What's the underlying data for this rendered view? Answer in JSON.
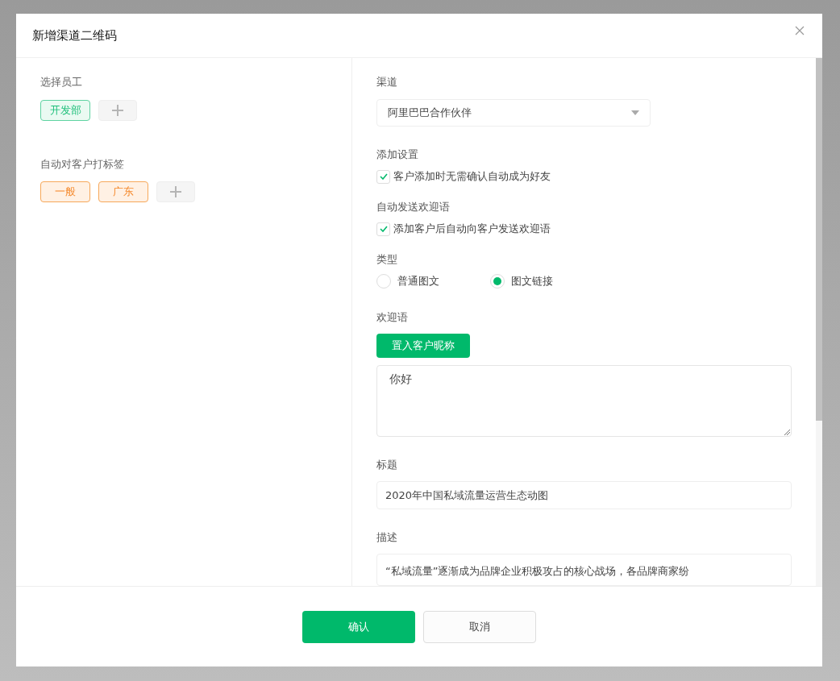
{
  "dialog": {
    "title": "新增渠道二维码"
  },
  "employees": {
    "label": "选择员工",
    "tags": [
      {
        "label": "开发部"
      }
    ]
  },
  "customer_tags": {
    "label": "自动对客户打标签",
    "tags": [
      {
        "label": "一般"
      },
      {
        "label": "广东"
      }
    ]
  },
  "channel": {
    "label": "渠道",
    "value": "阿里巴巴合作伙伴"
  },
  "add_settings": {
    "label": "添加设置",
    "option": {
      "label": "客户添加时无需确认自动成为好友",
      "checked": true
    }
  },
  "auto_welcome": {
    "label": "自动发送欢迎语",
    "option": {
      "label": "添加客户后自动向客户发送欢迎语",
      "checked": true
    }
  },
  "type": {
    "label": "类型",
    "options": [
      {
        "label": "普通图文",
        "selected": false
      },
      {
        "label": "图文链接",
        "selected": true
      }
    ]
  },
  "welcome": {
    "label": "欢迎语",
    "insert_button": "置入客户昵称",
    "value": "你好"
  },
  "title_field": {
    "label": "标题",
    "value": "2020年中国私域流量运营生态动图"
  },
  "description": {
    "label": "描述",
    "value": "“私域流量”逐渐成为品牌企业积极攻占的核心战场，各品牌商家纷"
  },
  "buttons": {
    "confirm": "确认",
    "cancel": "取消"
  }
}
